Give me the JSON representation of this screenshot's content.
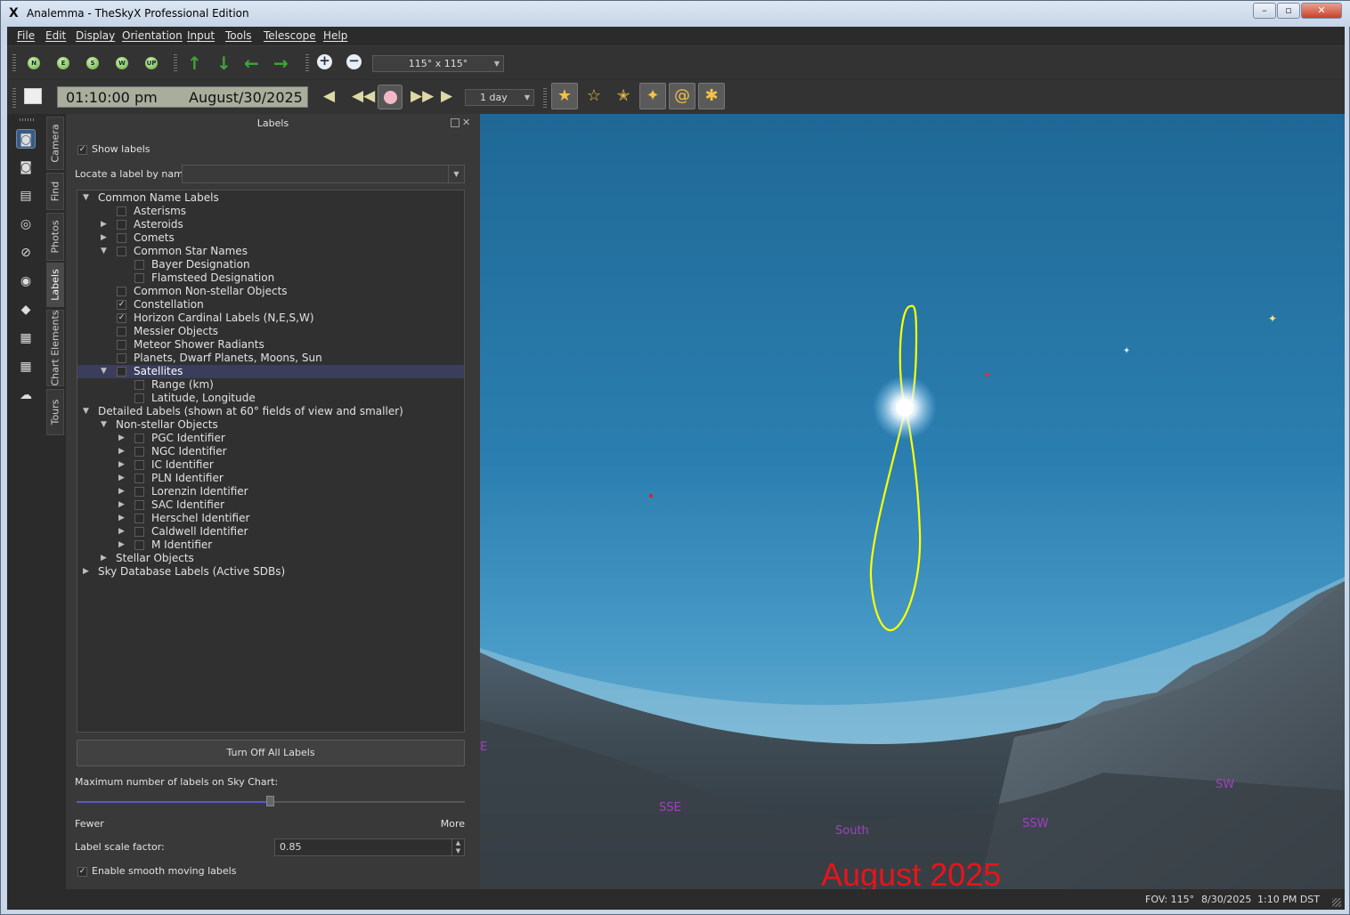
{
  "window": {
    "title": "Analemma - TheSkyX Professional Edition",
    "logo": "X"
  },
  "menu": [
    "File",
    "Edit",
    "Display",
    "Orientation",
    "Input",
    "Tools",
    "Telescope",
    "Help"
  ],
  "toolbar1": {
    "direction_buttons": [
      "N",
      "E",
      "S",
      "W",
      "UP"
    ],
    "fov_value": "115° x 115°"
  },
  "toolbar2": {
    "time": "01:10:00 pm",
    "date": "August/30/2025",
    "step": "1 day"
  },
  "side_tabs": [
    "Camera",
    "Find",
    "Photos",
    "Labels",
    "Chart Elements",
    "Tours"
  ],
  "panel": {
    "title": "Labels",
    "show_labels": "Show labels",
    "locate_label": "Locate a label by name:",
    "turn_off": "Turn Off All Labels",
    "max_labels": "Maximum number of labels on Sky Chart:",
    "max_labels_fraction": 0.5,
    "fewer": "Fewer",
    "more": "More",
    "scale_label": "Label scale factor:",
    "scale_value": "0.85",
    "smooth": "Enable smooth moving labels",
    "tree": [
      {
        "label": "Common Name Labels",
        "indent": 0,
        "twisty": "open",
        "check": null
      },
      {
        "label": "Asterisms",
        "indent": 2,
        "twisty": null,
        "check": false
      },
      {
        "label": "Asteroids",
        "indent": 1,
        "twisty": "closed",
        "check": false
      },
      {
        "label": "Comets",
        "indent": 1,
        "twisty": "closed",
        "check": false
      },
      {
        "label": "Common Star Names",
        "indent": 1,
        "twisty": "open",
        "check": false
      },
      {
        "label": "Bayer Designation",
        "indent": 3,
        "twisty": null,
        "check": false
      },
      {
        "label": "Flamsteed Designation",
        "indent": 3,
        "twisty": null,
        "check": false
      },
      {
        "label": "Common Non-stellar Objects",
        "indent": 2,
        "twisty": null,
        "check": false
      },
      {
        "label": "Constellation",
        "indent": 2,
        "twisty": null,
        "check": true
      },
      {
        "label": "Horizon Cardinal Labels (N,E,S,W)",
        "indent": 2,
        "twisty": null,
        "check": true
      },
      {
        "label": "Messier Objects",
        "indent": 2,
        "twisty": null,
        "check": false
      },
      {
        "label": "Meteor Shower Radiants",
        "indent": 2,
        "twisty": null,
        "check": false
      },
      {
        "label": "Planets, Dwarf Planets, Moons, Sun",
        "indent": 2,
        "twisty": null,
        "check": false
      },
      {
        "label": "Satellites",
        "indent": 1,
        "twisty": "open",
        "check": false,
        "selected": true
      },
      {
        "label": "Range (km)",
        "indent": 3,
        "twisty": null,
        "check": false
      },
      {
        "label": "Latitude, Longitude",
        "indent": 3,
        "twisty": null,
        "check": false
      },
      {
        "label": "Detailed Labels (shown at 60° fields of view and smaller)",
        "indent": 0,
        "twisty": "open",
        "check": null
      },
      {
        "label": "Non-stellar Objects",
        "indent": 1,
        "twisty": "open",
        "check": null
      },
      {
        "label": "PGC Identifier",
        "indent": 2,
        "twisty": "closed",
        "check": false
      },
      {
        "label": "NGC Identifier",
        "indent": 2,
        "twisty": "closed",
        "check": false
      },
      {
        "label": "IC Identifier",
        "indent": 2,
        "twisty": "closed",
        "check": false
      },
      {
        "label": "PLN Identifier",
        "indent": 2,
        "twisty": "closed",
        "check": false
      },
      {
        "label": "Lorenzin Identifier",
        "indent": 2,
        "twisty": "closed",
        "check": false
      },
      {
        "label": "SAC Identifier",
        "indent": 2,
        "twisty": "closed",
        "check": false
      },
      {
        "label": "Herschel Identifier",
        "indent": 2,
        "twisty": "closed",
        "check": false
      },
      {
        "label": "Caldwell Identifier",
        "indent": 2,
        "twisty": "closed",
        "check": false
      },
      {
        "label": "M Identifier",
        "indent": 2,
        "twisty": "closed",
        "check": false
      },
      {
        "label": "Stellar Objects",
        "indent": 1,
        "twisty": "closed",
        "check": null
      },
      {
        "label": "Sky Database Labels (Active SDBs)",
        "indent": 0,
        "twisty": "closed",
        "check": null
      }
    ]
  },
  "sky": {
    "horizon_labels": [
      "E",
      "SSE",
      "South",
      "SSW",
      "SW"
    ],
    "caption": "August 2025",
    "colors": {
      "analemma": "#ffff00",
      "caption": "#e8141a",
      "horizon_label": "#a040c0"
    }
  },
  "status": {
    "fov": "FOV: 115°",
    "date": "8/30/2025",
    "time": "1:10 PM DST"
  }
}
